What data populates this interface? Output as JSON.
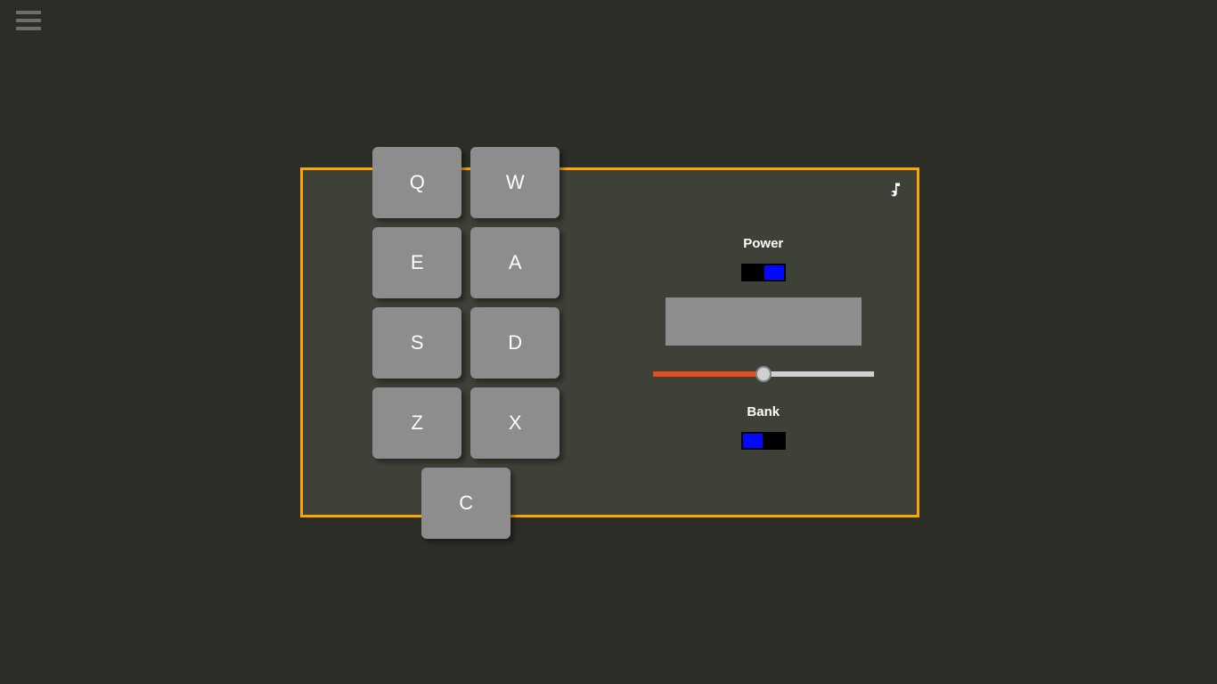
{
  "pads": [
    {
      "label": "Q"
    },
    {
      "label": "W"
    },
    {
      "label": "E"
    },
    {
      "label": "A"
    },
    {
      "label": "S"
    },
    {
      "label": "D"
    },
    {
      "label": "Z"
    },
    {
      "label": "X"
    },
    {
      "label": "C"
    }
  ],
  "controls": {
    "power_label": "Power",
    "power_on": true,
    "display_text": "",
    "volume": 50,
    "bank_label": "Bank",
    "bank_on": false
  }
}
